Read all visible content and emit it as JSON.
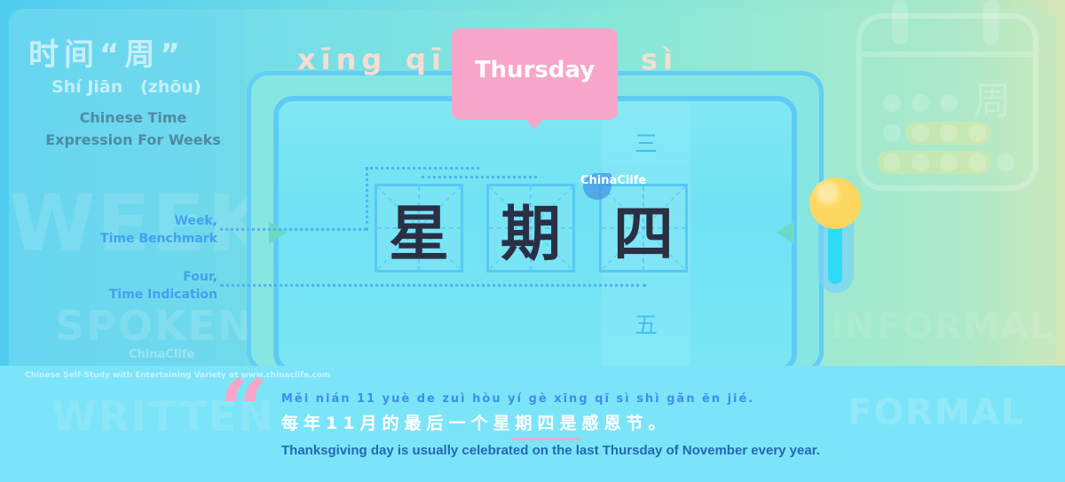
{
  "header": {
    "title_zh": "时间“周”",
    "title_pinyin": "Shí Jiān   (zhōu)",
    "subtitle_line1": "Chinese Time",
    "subtitle_line2": "Expression For Weeks"
  },
  "watermarks": {
    "week": "WEEK",
    "spoken": "SPOKEN",
    "written": "WRITTEN",
    "formal": "FORMAL",
    "informal": "INFORMAL"
  },
  "word": {
    "pinyin": [
      "xīng",
      "qī",
      "sì"
    ],
    "translation": "Thursday",
    "characters": [
      "星",
      "期",
      "四"
    ],
    "prev_number": "三",
    "next_number": "五"
  },
  "annotations": [
    {
      "line1": "Week,",
      "line2": "Time Benchmark"
    },
    {
      "line1": "Four,",
      "line2": "Time Indication"
    }
  ],
  "logo": {
    "text": "ChinaClife"
  },
  "calendar_icon": {
    "char": "周"
  },
  "footer": {
    "site_credit": "Chinese Self-Study with Entertaining Variety at www.chinaclife.com"
  },
  "example": {
    "pinyin": "Měi nián 11 yuè de zuì hòu yí gè xīng qī sì shì gǎn ēn jié.",
    "chinese": "每年11月的最后一个星期四是感恩节。",
    "english": "Thanksgiving day is usually celebrated on the last Thursday of November every year."
  },
  "colors": {
    "accent_pink": "#f7a6c9",
    "accent_blue": "#3ea2f0",
    "character_dark": "#2a2f45",
    "lever_yellow": "#fdd55a"
  }
}
